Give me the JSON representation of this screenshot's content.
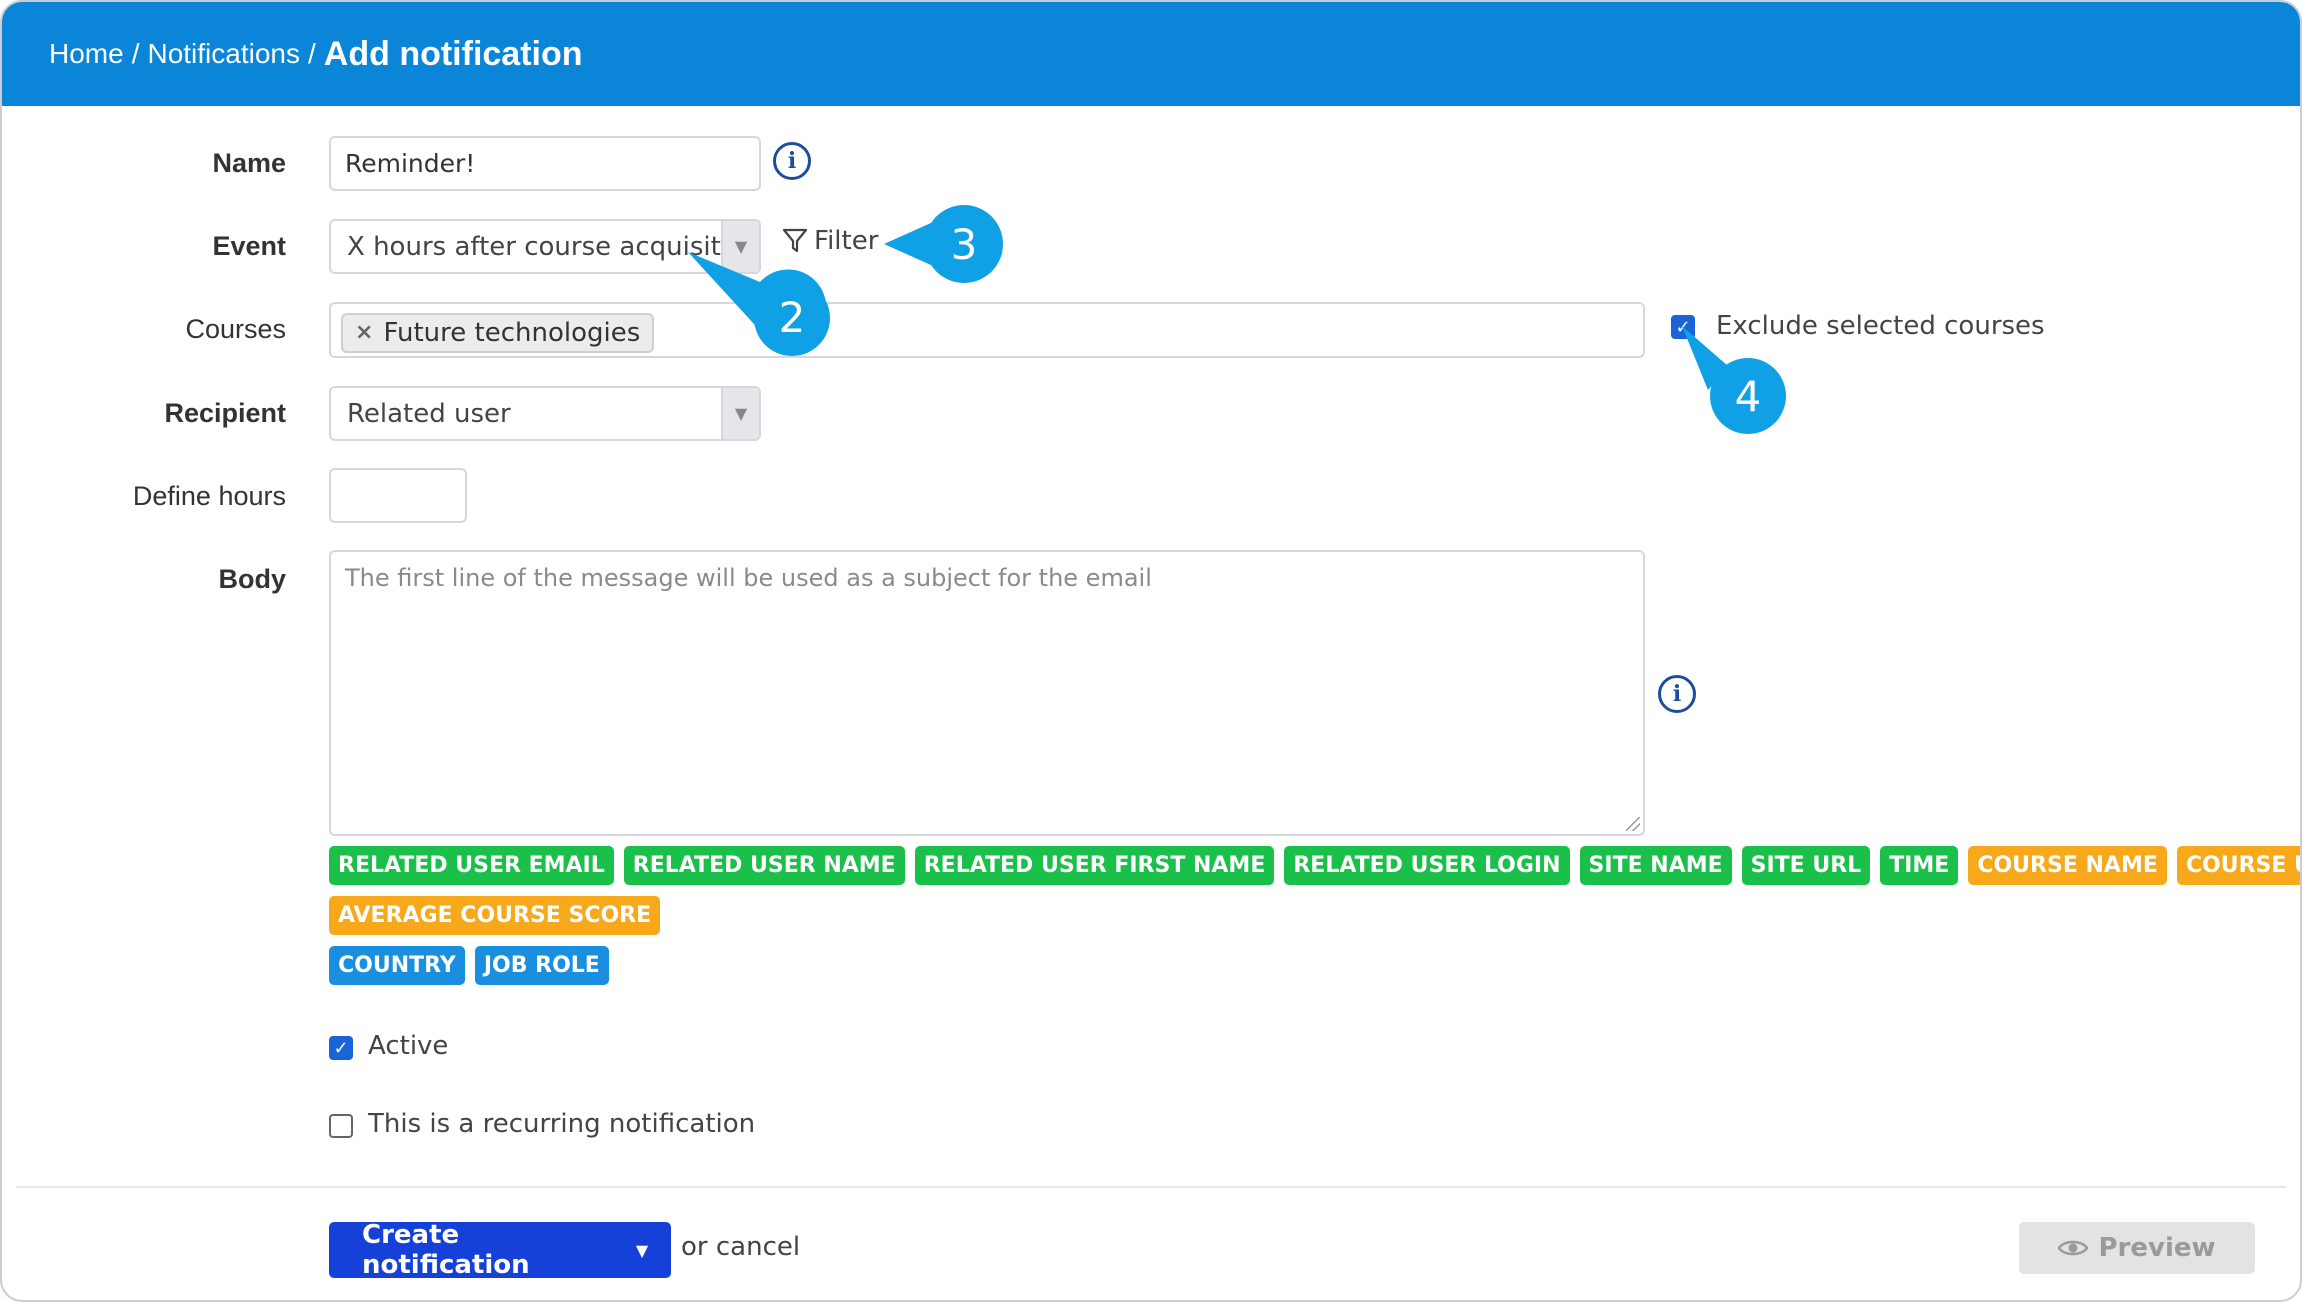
{
  "breadcrumb": {
    "home": "Home",
    "notifications": "Notifications",
    "current": "Add notification"
  },
  "form": {
    "name_label": "Name",
    "name_value": "Reminder!",
    "event_label": "Event",
    "event_value": "X hours after course acquisit...",
    "filter_label": "Filter",
    "courses_label": "Courses",
    "courses_tags": [
      "Future technologies"
    ],
    "exclude_label": "Exclude selected courses",
    "exclude_checked": true,
    "recipient_label": "Recipient",
    "recipient_value": "Related user",
    "define_hours_label": "Define hours",
    "define_hours_value": "",
    "body_label": "Body",
    "body_placeholder": "The first line of the message will be used as a subject for the email",
    "active_label": "Active",
    "active_checked": true,
    "recurring_label": "This is a recurring notification",
    "recurring_checked": false
  },
  "placeholders": {
    "row1": [
      {
        "label": "RELATED USER EMAIL",
        "color": "#1bc04a"
      },
      {
        "label": "RELATED USER NAME",
        "color": "#1bc04a"
      },
      {
        "label": "RELATED USER FIRST NAME",
        "color": "#1bc04a"
      },
      {
        "label": "RELATED USER LOGIN",
        "color": "#1bc04a"
      },
      {
        "label": "SITE NAME",
        "color": "#1bc04a"
      },
      {
        "label": "SITE URL",
        "color": "#1bc04a"
      },
      {
        "label": "TIME",
        "color": "#1bc04a"
      },
      {
        "label": "COURSE NAME",
        "color": "#f7a81b"
      },
      {
        "label": "COURSE URL",
        "color": "#f7a81b"
      }
    ],
    "row2": [
      {
        "label": "AVERAGE COURSE SCORE",
        "color": "#f7a81b"
      }
    ],
    "row3": [
      {
        "label": "COUNTRY",
        "color": "#1a8fe0"
      },
      {
        "label": "JOB ROLE",
        "color": "#1a8fe0"
      }
    ]
  },
  "footer": {
    "create_label": "Create notification",
    "or_cancel": "or cancel",
    "preview_label": "Preview"
  },
  "callouts": [
    "2",
    "3",
    "4"
  ],
  "colors": {
    "header_bg": "#0a85d7",
    "primary_button": "#1541d8",
    "callout": "#0fa0e6"
  }
}
